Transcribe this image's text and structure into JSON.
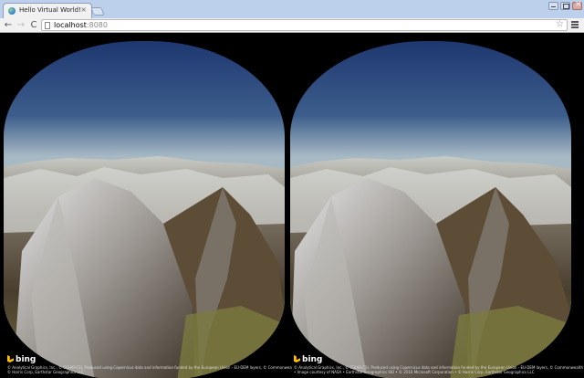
{
  "browser": {
    "tab_title": "Hello Virtual World!",
    "tab_close": "×",
    "url_host": "localhost",
    "url_port": ":8080",
    "star": "☆",
    "back": "←",
    "forward": "→",
    "reload": "C"
  },
  "viewer": {
    "bing_label": "bing",
    "credit_left": "© Analytical Graphics, Inc., © CGIAR-CSI, Produced using Copernicus data and information funded by the European Union - EU-DEM layers, © Commonwealth of Australia (Geoscience Australia) 2012, © Microsoft Corporation",
    "credit_left_line2": "© Harris Corp, Earthstar Geographics LLC",
    "credit_right": "© Analytical Graphics, Inc., © CGIAR-CSI, Produced using Copernicus data and information funded by the European Union - EU-DEM layers, © Commonwealth of Australia",
    "credit_right_line2": "• Image courtesy of NASA • Earthstar Geographics SIO • © 2016 Microsoft Corporation • © Harris Corp, Earthstar Geographics LLC",
    "sky_top": "#1e3770",
    "sky_horizon": "#a7b9c4",
    "mountain_color": "#6d5e47"
  }
}
